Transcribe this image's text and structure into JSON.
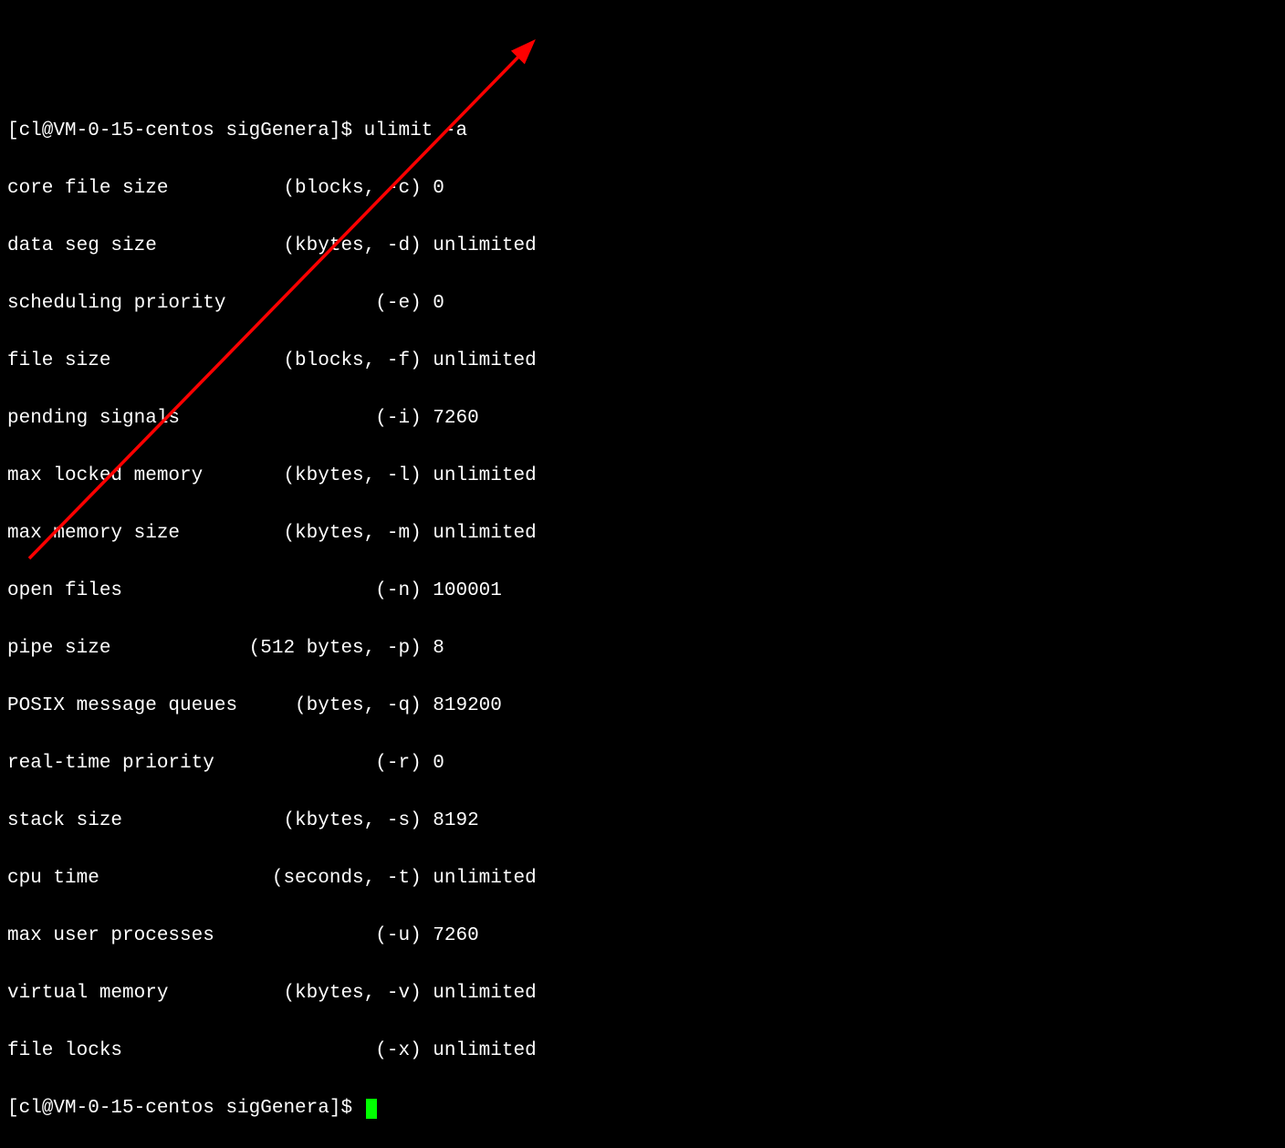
{
  "prompt1": {
    "prefix": "[cl@VM-0-15-centos sigGenera]$ ",
    "command": "ulimit -a"
  },
  "lines": [
    "core file size          (blocks, -c) 0",
    "data seg size           (kbytes, -d) unlimited",
    "scheduling priority             (-e) 0",
    "file size               (blocks, -f) unlimited",
    "pending signals                 (-i) 7260",
    "max locked memory       (kbytes, -l) unlimited",
    "max memory size         (kbytes, -m) unlimited",
    "open files                      (-n) 100001",
    "pipe size            (512 bytes, -p) 8",
    "POSIX message queues     (bytes, -q) 819200",
    "real-time priority              (-r) 0",
    "stack size              (kbytes, -s) 8192",
    "cpu time               (seconds, -t) unlimited",
    "max user processes              (-u) 7260",
    "virtual memory          (kbytes, -v) unlimited",
    "file locks                      (-x) unlimited"
  ],
  "prompt2": {
    "prefix": "[cl@VM-0-15-centos sigGenera]$ "
  },
  "annotation": {
    "color": "#ff0000"
  }
}
